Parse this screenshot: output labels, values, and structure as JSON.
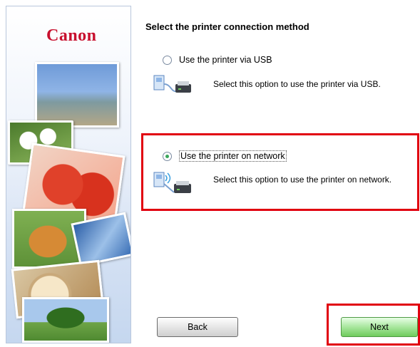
{
  "brand": {
    "logo_text": "Canon",
    "accent": "#c8102e"
  },
  "page": {
    "title": "Select the printer connection method"
  },
  "options": [
    {
      "label": "Use the printer via USB",
      "description": "Select this option to use the printer via USB.",
      "selected": false,
      "icon": "usb-connection-icon"
    },
    {
      "label": "Use the printer on network",
      "description": "Select this option to use the printer on network.",
      "selected": true,
      "icon": "network-connection-icon"
    }
  ],
  "buttons": {
    "back": "Back",
    "next": "Next"
  },
  "colors": {
    "highlight": "#e1000f",
    "next_button": "#6fcb5d",
    "radio_selected": "#3aa65a"
  }
}
